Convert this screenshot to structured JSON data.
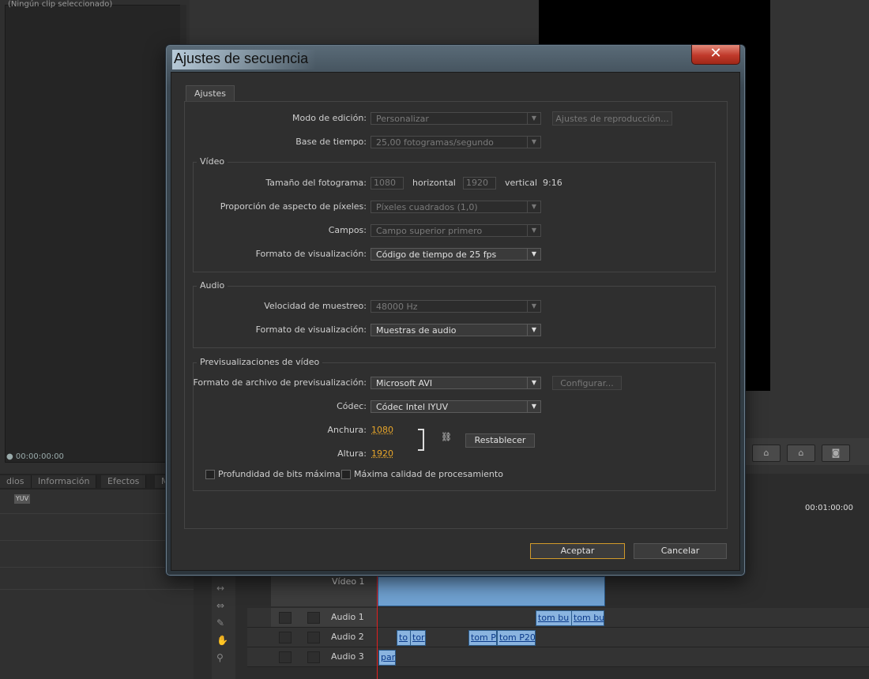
{
  "background": {
    "source_header": "(Ningún clip seleccionado)",
    "source_timecode": "00:00:00:00",
    "panel_tabs": [
      "dios",
      "Información",
      "Efectos",
      "M"
    ],
    "yuv_label": "YUV",
    "timeline_timecode": "00:01:00:00",
    "tracks": [
      {
        "name": "Audio 1"
      },
      {
        "name": "Audio 2"
      },
      {
        "name": "Audio 3"
      }
    ],
    "video_track_name": "Vídeo 1",
    "audio_clips": [
      "tom bu",
      "tom bu",
      "to",
      "tor",
      "tom P",
      "tom P20:",
      "pan"
    ]
  },
  "dialog": {
    "title": "Ajustes de secuencia",
    "close_glyph": "✕",
    "tab": "Ajustes",
    "edit_mode": {
      "label": "Modo de edición:",
      "value": "Personalizar"
    },
    "playback_settings_button": "Ajustes de reproducción...",
    "timebase": {
      "label": "Base de tiempo:",
      "value": "25,00 fotogramas/segundo"
    },
    "video": {
      "group_title": "Vídeo",
      "frame_size_label": "Tamaño del fotograma:",
      "width": "1080",
      "horizontal_label": "horizontal",
      "height": "1920",
      "vertical_label": "vertical",
      "aspect": "9:16",
      "par_label": "Proporción de aspecto de píxeles:",
      "par_value": "Píxeles cuadrados (1,0)",
      "fields_label": "Campos:",
      "fields_value": "Campo superior primero",
      "display_format_label": "Formato de visualización:",
      "display_format_value": "Código de tiempo de 25 fps"
    },
    "audio": {
      "group_title": "Audio",
      "sample_rate_label": "Velocidad de muestreo:",
      "sample_rate_value": "48000 Hz",
      "display_format_label": "Formato de visualización:",
      "display_format_value": "Muestras de audio"
    },
    "previews": {
      "group_title": "Previsualizaciones de vídeo",
      "file_format_label": "Formato de archivo de previsualización:",
      "file_format_value": "Microsoft AVI",
      "configure_button": "Configurar...",
      "codec_label": "Códec:",
      "codec_value": "Códec Intel IYUV",
      "width_label": "Anchura:",
      "width_value": "1080",
      "height_label": "Altura:",
      "height_value": "1920",
      "reset_button": "Restablecer",
      "max_bit_depth_label": "Profundidad de bits máxima",
      "max_render_quality_label": "Máxima calidad de procesamiento"
    },
    "ok_button": "Aceptar",
    "cancel_button": "Cancelar"
  }
}
